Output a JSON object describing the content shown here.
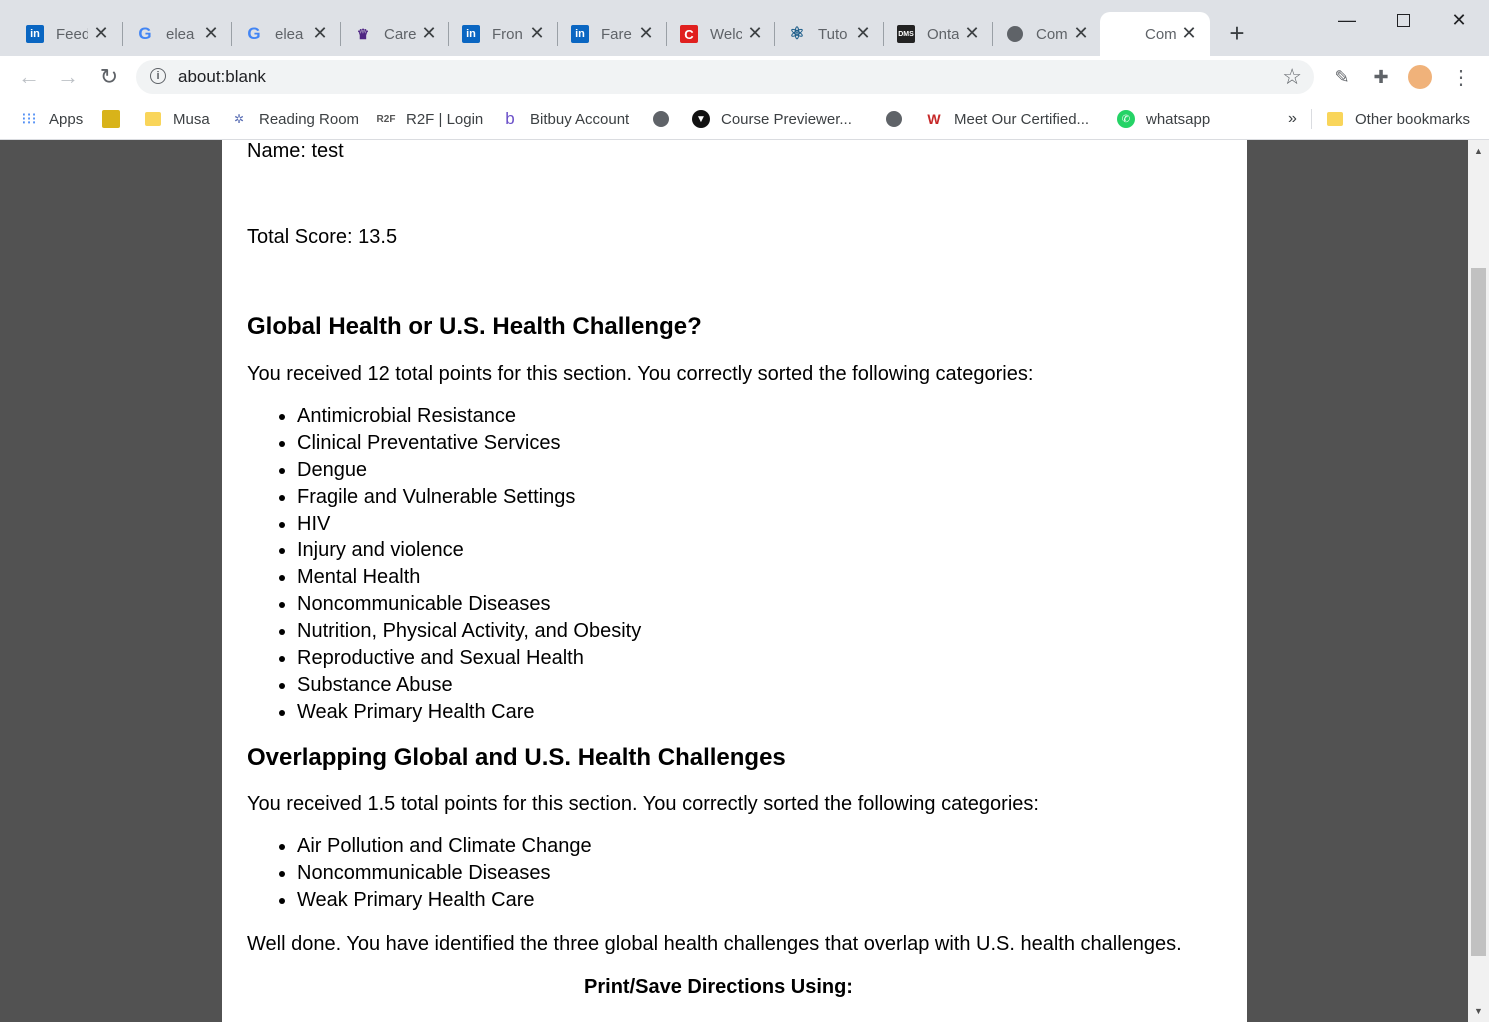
{
  "tabs": [
    {
      "title": "Feed",
      "icon": "linkedin-icon"
    },
    {
      "title": "elea",
      "icon": "google-icon"
    },
    {
      "title": "elea",
      "icon": "google-icon"
    },
    {
      "title": "Care",
      "icon": "university-crest-icon"
    },
    {
      "title": "Fron",
      "icon": "linkedin-icon"
    },
    {
      "title": "Fare",
      "icon": "linkedin-icon"
    },
    {
      "title": "Welc",
      "icon": "c-logo-icon"
    },
    {
      "title": "Tuto",
      "icon": "react-icon"
    },
    {
      "title": "Onta",
      "icon": "dms-icon"
    },
    {
      "title": "Com",
      "icon": "globe-icon"
    },
    {
      "title": "Com",
      "icon": "none"
    }
  ],
  "address_bar": {
    "url": "about:blank"
  },
  "bookmarks": [
    {
      "label": "Apps",
      "icon": "apps-grid-icon"
    },
    {
      "label": "",
      "icon": "turtle-icon"
    },
    {
      "label": "Musa",
      "icon": "folder-icon"
    },
    {
      "label": "Reading Room",
      "icon": "reading-room-icon"
    },
    {
      "label": "R2F | Login",
      "icon": "r2f-icon"
    },
    {
      "label": "Bitbuy Account",
      "icon": "bitbuy-icon"
    },
    {
      "label": "",
      "icon": "globe-icon"
    },
    {
      "label": "Course Previewer...",
      "icon": "course-icon"
    },
    {
      "label": "",
      "icon": "globe-icon"
    },
    {
      "label": "Meet Our Certified...",
      "icon": "certified-icon"
    },
    {
      "label": "whatsapp",
      "icon": "whatsapp-icon"
    }
  ],
  "bookmarks_overflow": "»",
  "other_bookmarks": "Other bookmarks",
  "report": {
    "name_line": "Name: test",
    "total_score": "Total Score: 13.5",
    "section1": {
      "heading": "Global Health or U.S. Health Challenge?",
      "summary": "You received 12 total points for this section. You correctly sorted the following categories:",
      "items": [
        "Antimicrobial Resistance",
        "Clinical Preventative Services",
        "Dengue",
        "Fragile and Vulnerable Settings",
        "HIV",
        "Injury and violence",
        "Mental Health",
        "Noncommunicable Diseases",
        "Nutrition, Physical Activity, and Obesity",
        "Reproductive and Sexual Health",
        "Substance Abuse",
        "Weak Primary Health Care"
      ]
    },
    "section2": {
      "heading": "Overlapping Global and U.S. Health Challenges",
      "summary": "You received 1.5 total points for this section. You correctly sorted the following categories:",
      "items": [
        "Air Pollution and Climate Change",
        "Noncommunicable Diseases",
        "Weak Primary Health Care"
      ]
    },
    "feedback": "Well done. You have identified the three global health challenges that overlap with U.S. health challenges.",
    "print_heading": "Print/Save Directions Using:"
  }
}
